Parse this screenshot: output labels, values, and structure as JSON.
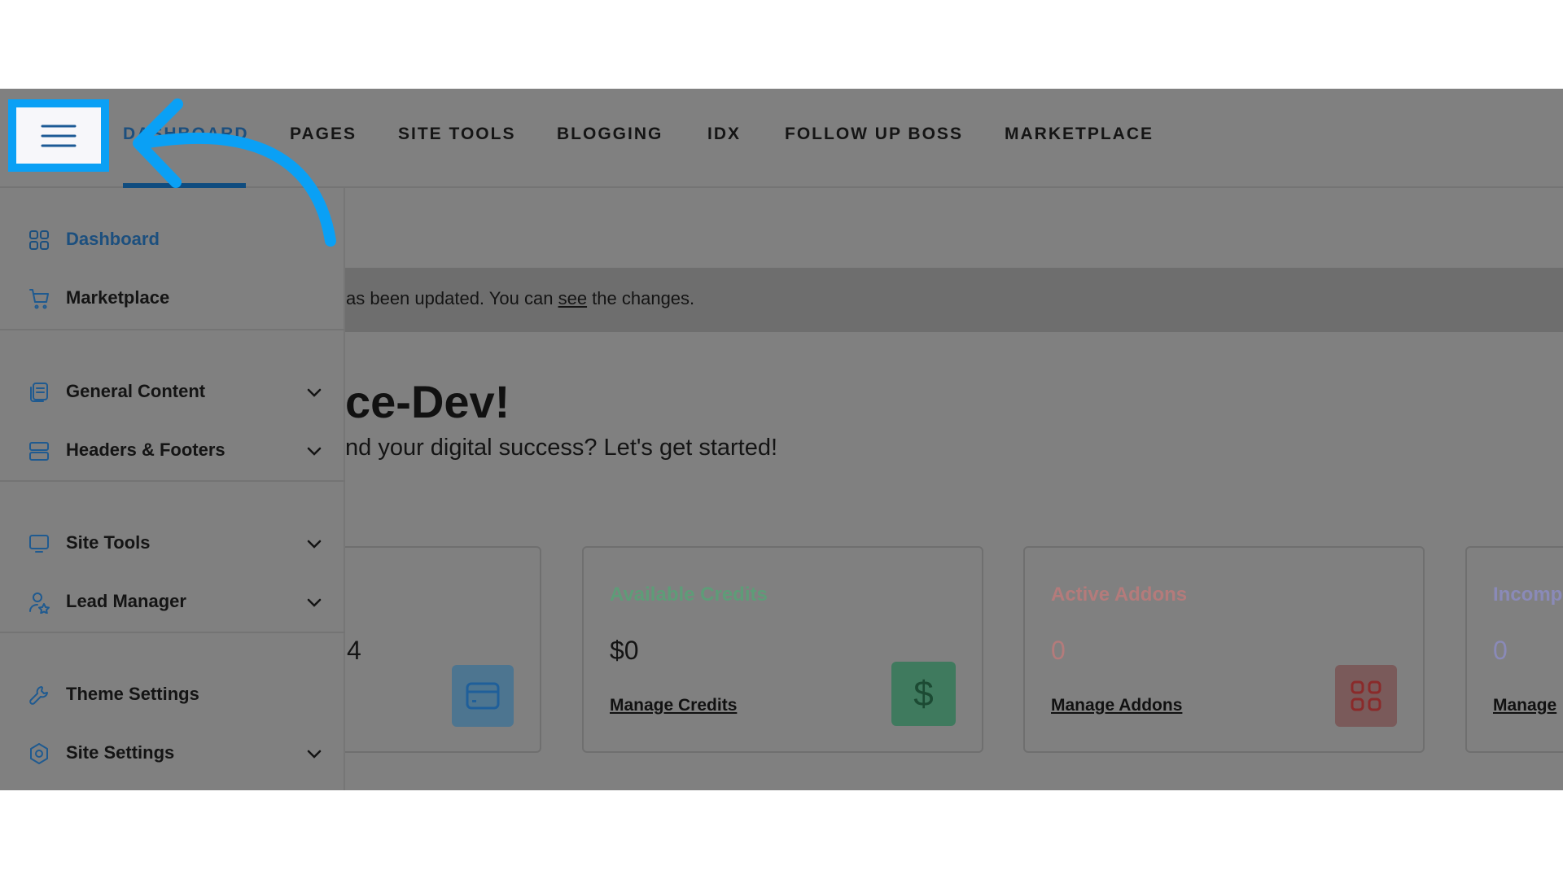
{
  "topnav": {
    "items": [
      {
        "label": "DASHBOARD",
        "active": true
      },
      {
        "label": "PAGES"
      },
      {
        "label": "SITE TOOLS"
      },
      {
        "label": "BLOGGING"
      },
      {
        "label": "IDX"
      },
      {
        "label": "FOLLOW UP BOSS"
      },
      {
        "label": "MARKETPLACE"
      }
    ]
  },
  "sidebar": {
    "items": [
      {
        "label": "Dashboard",
        "icon": "grid-icon",
        "active": true
      },
      {
        "label": "Marketplace",
        "icon": "cart-icon"
      },
      {
        "label": "General Content",
        "icon": "documents-icon",
        "expandable": true
      },
      {
        "label": "Headers & Footers",
        "icon": "layout-icon",
        "expandable": true
      },
      {
        "label": "Site Tools",
        "icon": "monitor-icon",
        "expandable": true
      },
      {
        "label": "Lead Manager",
        "icon": "user-star-icon",
        "expandable": true
      },
      {
        "label": "Theme Settings",
        "icon": "wrench-icon"
      },
      {
        "label": "Site Settings",
        "icon": "gear-icon",
        "expandable": true
      }
    ]
  },
  "notice": {
    "before": "as been updated. You can ",
    "link": "see",
    "after": " the changes."
  },
  "main": {
    "heading": "ce-Dev!",
    "subtitle": "nd your digital success? Let's get started!"
  },
  "cards": [
    {
      "title": "",
      "value": "4",
      "link": "",
      "icon": "credit-card-icon"
    },
    {
      "title": "Available Credits",
      "value": "$0",
      "link": "Manage Credits",
      "icon": "dollar-icon",
      "color": "#5e9c78"
    },
    {
      "title": "Active Addons",
      "value": "0",
      "link": "Manage Addons",
      "icon": "grid-icon",
      "color": "#b47b7b"
    },
    {
      "title": "Incomp",
      "value": "0",
      "link": "Manage",
      "color": "#8a8ab8"
    }
  ],
  "colors": {
    "highlight": "#0aa0f5",
    "accent": "#1c4f7e",
    "overlay": "#808080"
  }
}
